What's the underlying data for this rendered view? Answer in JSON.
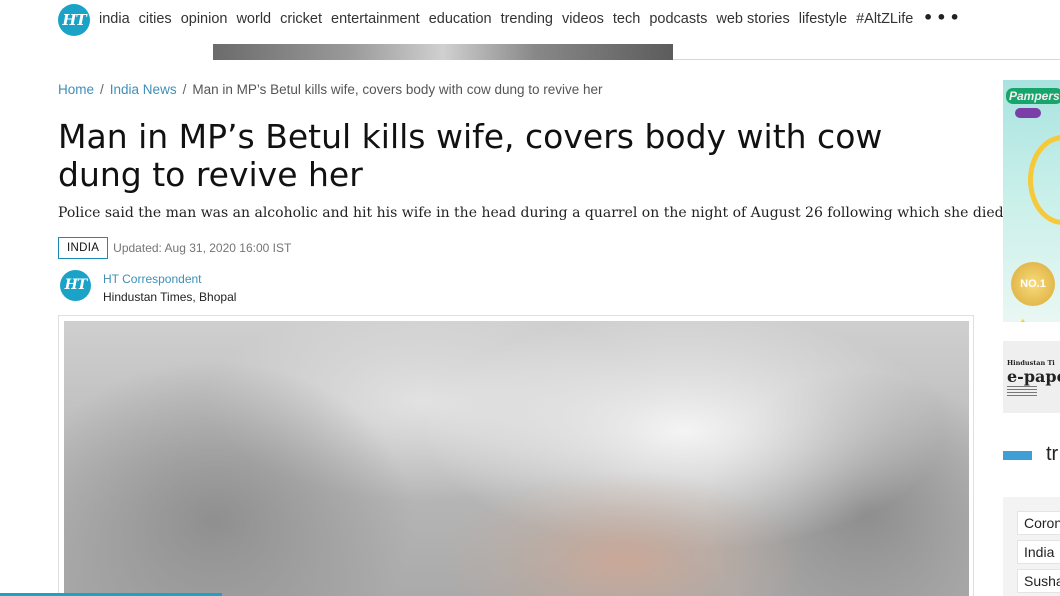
{
  "brand": {
    "logo_text": "HT"
  },
  "nav": {
    "links": [
      "india",
      "cities",
      "opinion",
      "world",
      "cricket",
      "entertainment",
      "education",
      "trending",
      "videos",
      "tech",
      "podcasts",
      "web stories",
      "lifestyle",
      "#AltZLife"
    ],
    "more_icon": "•••"
  },
  "breadcrumb": {
    "home": "Home",
    "section": "India News",
    "separator": "/",
    "current": "Man in MP’s Betul kills wife, covers body with cow dung to revive her"
  },
  "article": {
    "headline": "Man in MP’s Betul kills wife, covers body with cow dung to revive her",
    "summary": "Police said the man was an alcoholic and hit his wife in the head during a quarrel on the night of August 26 following which she died.",
    "section_tag": "INDIA",
    "updated": "Updated: Aug 31, 2020 16:00 IST",
    "author": "HT Correspondent",
    "author_org": "Hindustan Times, Bhopal",
    "byline_logo_text": "HT"
  },
  "right_rail": {
    "ad_brand": "Pampers",
    "ad_badge": "NO.1",
    "epaper_brand": "Hindustan Ti",
    "epaper_label": "e-pape",
    "section_heading": "tr",
    "trending_chips": [
      "Coron",
      "India",
      "Susha"
    ]
  },
  "colors": {
    "accent": "#1aa3c7",
    "link": "#3f8fb8",
    "rail_marker": "#3f9ed6"
  }
}
